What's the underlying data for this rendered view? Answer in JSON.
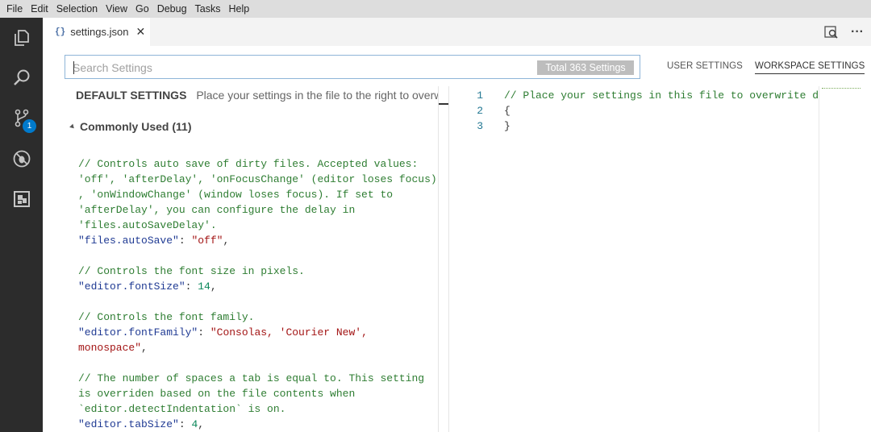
{
  "menu": [
    "File",
    "Edit",
    "Selection",
    "View",
    "Go",
    "Debug",
    "Tasks",
    "Help"
  ],
  "activity": {
    "badge_count": "1",
    "items": [
      "explorer-icon",
      "search-icon",
      "source-control-icon",
      "debug-icon",
      "extensions-icon"
    ]
  },
  "tab": {
    "icon": "{}",
    "label": "settings.json",
    "close": "✕"
  },
  "toolbar": {
    "more_label": "···"
  },
  "search": {
    "placeholder": "Search Settings",
    "value": "",
    "count": "Total 363 Settings"
  },
  "scopes": {
    "user": "USER SETTINGS",
    "workspace": "WORKSPACE SETTINGS"
  },
  "default_settings": {
    "title": "DEFAULT SETTINGS",
    "hint": "Place your settings in the file to the right to overwrite",
    "group": "Commonly Used (11)"
  },
  "default_code": [
    [
      {
        "t": "c",
        "v": "// Controls auto save of dirty files. Accepted values:"
      }
    ],
    [
      {
        "t": "c",
        "v": "'off', 'afterDelay', 'onFocusChange' (editor loses focus)"
      }
    ],
    [
      {
        "t": "c",
        "v": ", 'onWindowChange' (window loses focus). If set to"
      }
    ],
    [
      {
        "t": "c",
        "v": "'afterDelay', you can configure the delay in"
      }
    ],
    [
      {
        "t": "c",
        "v": "'files.autoSaveDelay'."
      }
    ],
    [
      {
        "t": "k",
        "v": "\"files.autoSave\""
      },
      {
        "t": "p",
        "v": ": "
      },
      {
        "t": "s",
        "v": "\"off\""
      },
      {
        "t": "p",
        "v": ","
      }
    ],
    [],
    [
      {
        "t": "c",
        "v": "// Controls the font size in pixels."
      }
    ],
    [
      {
        "t": "k",
        "v": "\"editor.fontSize\""
      },
      {
        "t": "p",
        "v": ": "
      },
      {
        "t": "n",
        "v": "14"
      },
      {
        "t": "p",
        "v": ","
      }
    ],
    [],
    [
      {
        "t": "c",
        "v": "// Controls the font family."
      }
    ],
    [
      {
        "t": "k",
        "v": "\"editor.fontFamily\""
      },
      {
        "t": "p",
        "v": ": "
      },
      {
        "t": "s",
        "v": "\"Consolas, 'Courier New',"
      }
    ],
    [
      {
        "t": "s",
        "v": "monospace\""
      },
      {
        "t": "p",
        "v": ","
      }
    ],
    [],
    [
      {
        "t": "c",
        "v": "// The number of spaces a tab is equal to. This setting"
      }
    ],
    [
      {
        "t": "c",
        "v": "is overriden based on the file contents when"
      }
    ],
    [
      {
        "t": "c",
        "v": "`editor.detectIndentation` is on."
      }
    ],
    [
      {
        "t": "k",
        "v": "\"editor.tabSize\""
      },
      {
        "t": "p",
        "v": ": "
      },
      {
        "t": "n",
        "v": "4"
      },
      {
        "t": "p",
        "v": ","
      }
    ]
  ],
  "user_editor": {
    "line_numbers": [
      "1",
      "2",
      "3"
    ],
    "lines": [
      [
        {
          "t": "c",
          "v": "// Place your settings in this file to overwrite default settings"
        }
      ],
      [
        {
          "t": "p",
          "v": "{"
        }
      ],
      [
        {
          "t": "p",
          "v": "}"
        }
      ]
    ]
  }
}
